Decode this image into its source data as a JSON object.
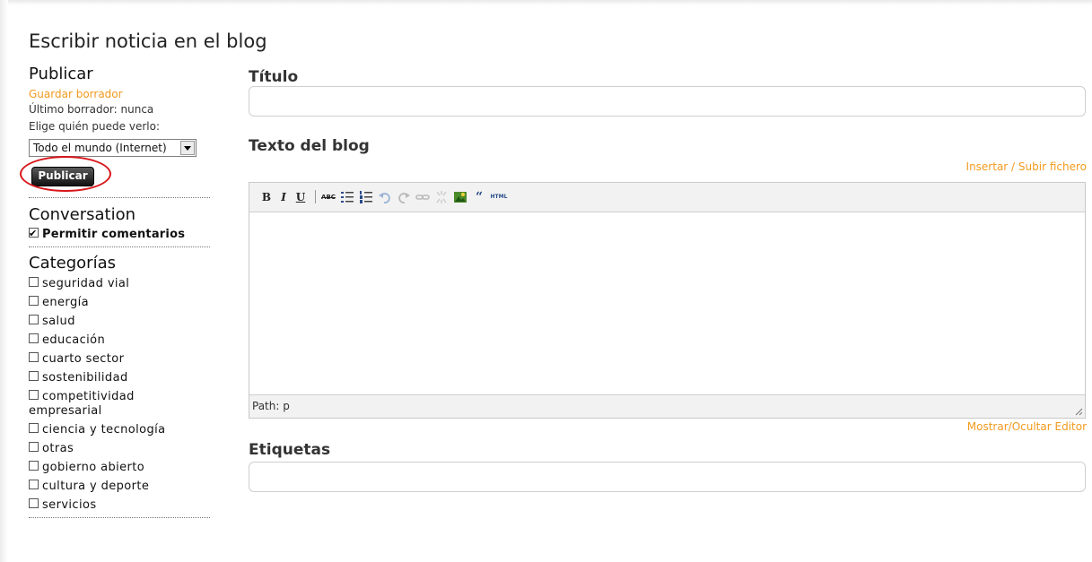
{
  "page_title": "Escribir noticia en el blog",
  "publish": {
    "title": "Publicar",
    "save_draft": "Guardar borrador",
    "last_draft": "Último borrador: nunca",
    "visibility_label": "Elige quién puede verlo:",
    "visibility_value": "Todo el mundo (Internet)",
    "button": "Publicar"
  },
  "conversation": {
    "title": "Conversation",
    "allow_comments": "Permitir comentarios",
    "allow_comments_checked": true
  },
  "categories": {
    "title": "Categorías",
    "items": [
      "seguridad vial",
      "energía",
      "salud",
      "educación",
      "cuarto sector",
      "sostenibilidad",
      "competitividad",
      "ciencia y tecnología",
      "otras",
      "gobierno abierto",
      "cultura y deporte",
      "servicios"
    ],
    "wrapped_continuation": "empresarial"
  },
  "title_field": {
    "label": "Título",
    "value": ""
  },
  "blog_text": {
    "label": "Texto del blog",
    "insert_link": "Insertar / Subir fichero",
    "toolbar": {
      "bold": "B",
      "italic": "I",
      "underline": "U",
      "spellcheck": "ABC",
      "html": "HTML"
    },
    "path": "Path: p",
    "toggle_editor": "Mostrar/Ocultar Editor"
  },
  "tags_field": {
    "label": "Etiquetas",
    "value": ""
  },
  "colors": {
    "link_orange": "#f39a1e",
    "highlight_red": "#d8161b",
    "button_dark": "#111111"
  }
}
